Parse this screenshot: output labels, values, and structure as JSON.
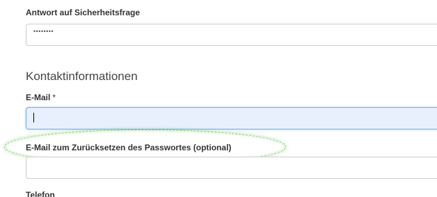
{
  "security_answer": {
    "label": "Antwort auf Sicherheitsfrage",
    "masked_value": "••••••••"
  },
  "contact_section": {
    "heading": "Kontaktinformationen"
  },
  "email": {
    "label": "E-Mail",
    "required_marker": "*",
    "value": ""
  },
  "reset_email": {
    "label": "E-Mail zum Zurücksetzen des Passwortes (optional)",
    "value": ""
  },
  "phone": {
    "label": "Telefon"
  },
  "highlight_color": "#7dc36b",
  "focus_color": "#66afe9"
}
